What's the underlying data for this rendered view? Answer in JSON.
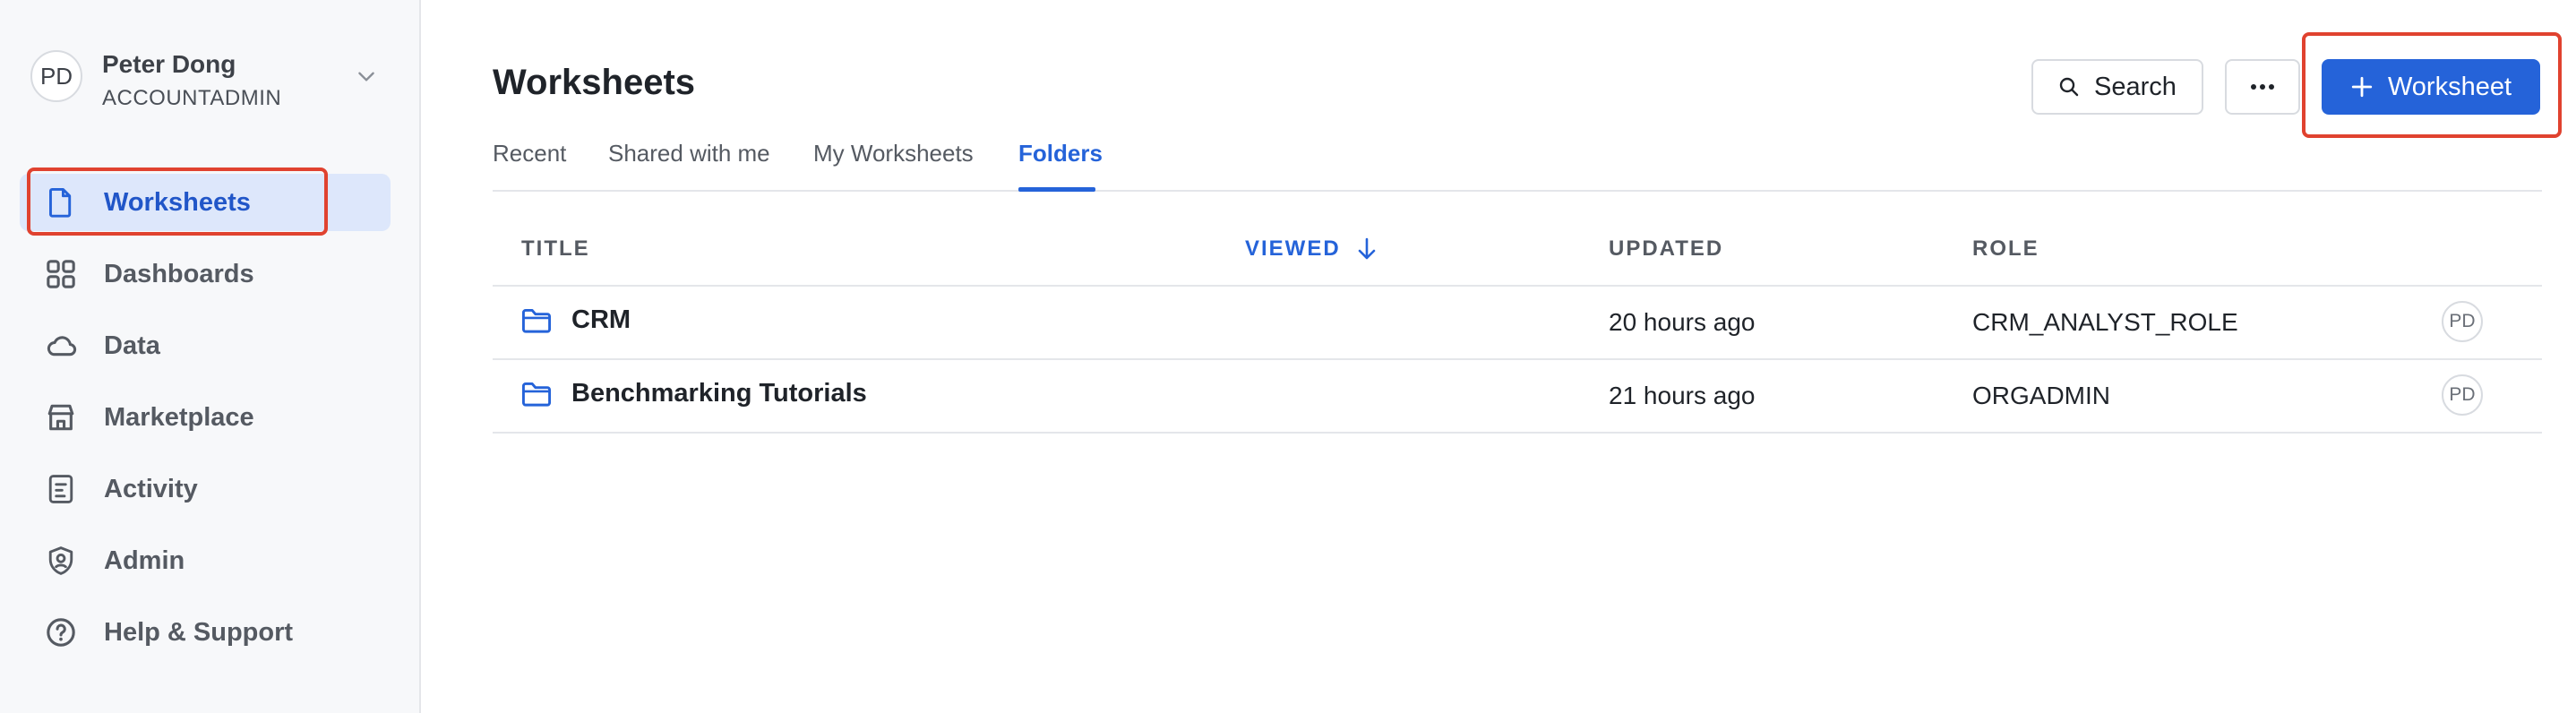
{
  "user": {
    "initials": "PD",
    "name": "Peter Dong",
    "role": "ACCOUNTADMIN"
  },
  "sidebar": {
    "items": [
      {
        "label": "Worksheets",
        "icon": "document-icon",
        "active": true
      },
      {
        "label": "Dashboards",
        "icon": "grid-icon"
      },
      {
        "label": "Data",
        "icon": "cloud-icon"
      },
      {
        "label": "Marketplace",
        "icon": "store-icon"
      },
      {
        "label": "Activity",
        "icon": "list-icon"
      },
      {
        "label": "Admin",
        "icon": "shield-icon"
      },
      {
        "label": "Help & Support",
        "icon": "help-icon"
      }
    ]
  },
  "header": {
    "title": "Worksheets",
    "search_label": "Search",
    "primary_label": "Worksheet"
  },
  "tabs": [
    {
      "label": "Recent"
    },
    {
      "label": "Shared with me"
    },
    {
      "label": "My Worksheets"
    },
    {
      "label": "Folders",
      "active": true
    }
  ],
  "table": {
    "columns": [
      "TITLE",
      "VIEWED",
      "UPDATED",
      "ROLE"
    ],
    "sorted_column": "VIEWED",
    "rows": [
      {
        "title": "CRM",
        "viewed": "",
        "updated": "20 hours ago",
        "role": "CRM_ANALYST_ROLE",
        "owner": "PD"
      },
      {
        "title": "Benchmarking Tutorials",
        "viewed": "",
        "updated": "21 hours ago",
        "role": "ORGADMIN",
        "owner": "PD"
      }
    ]
  },
  "colors": {
    "accent": "#2563d9",
    "highlight": "#e0422f",
    "active_bg": "#dde7fb"
  }
}
